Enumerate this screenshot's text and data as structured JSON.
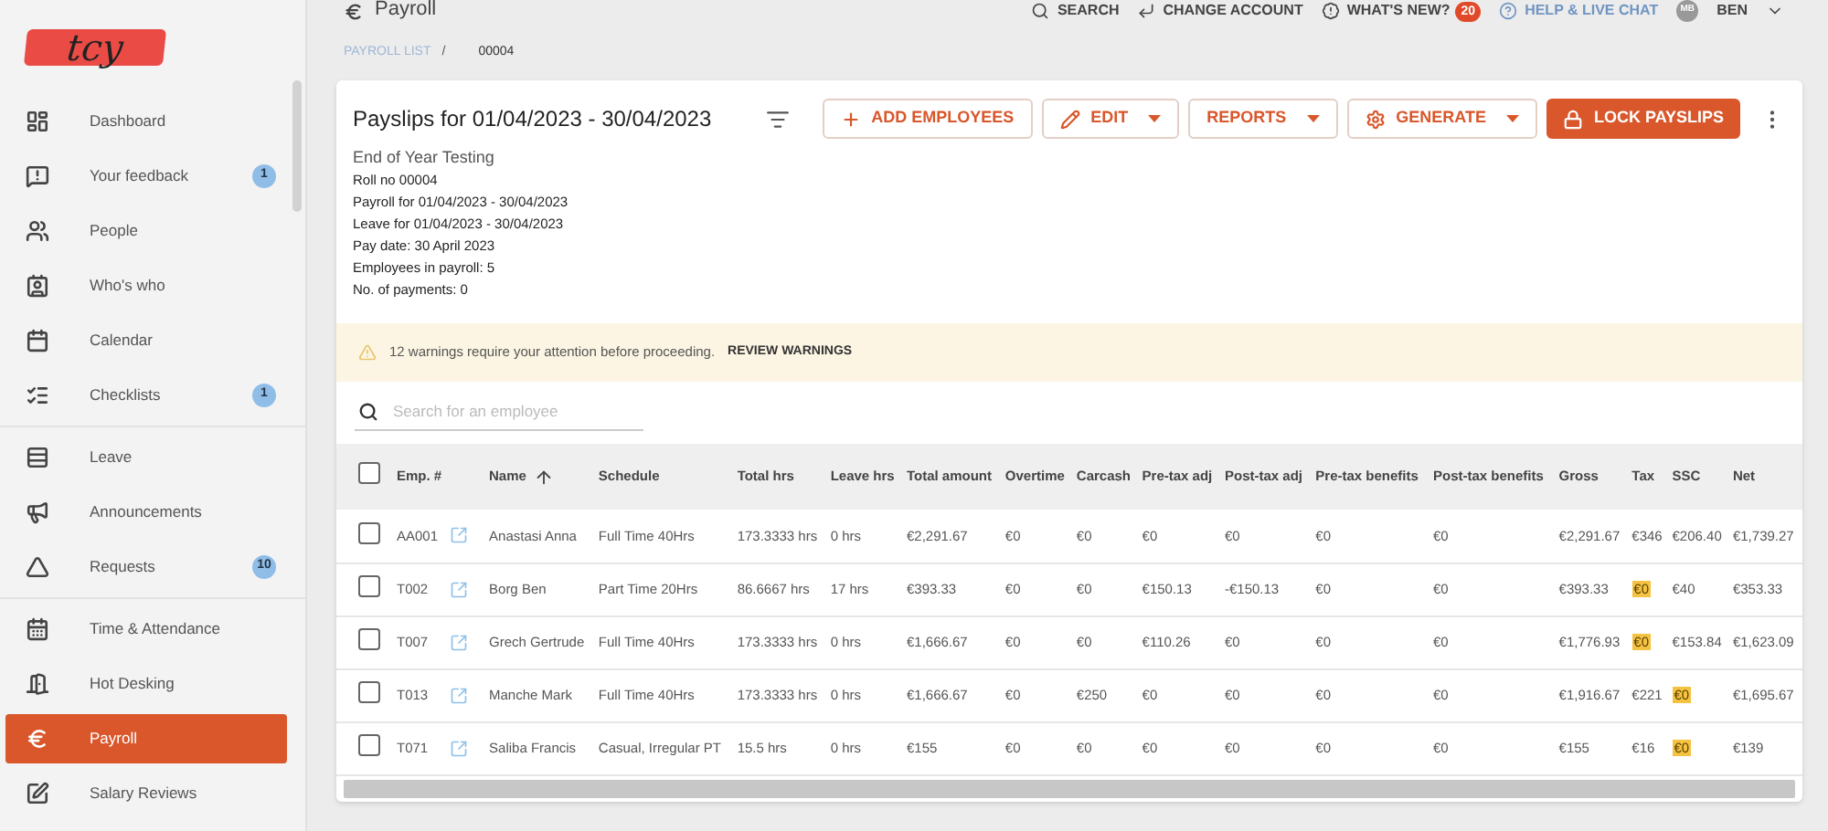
{
  "logo": {
    "text": "tcy"
  },
  "sidebar": {
    "items": [
      {
        "label": "Dashboard",
        "selected": false,
        "group_end": false
      },
      {
        "label": "Your feedback",
        "selected": false,
        "badge": "1",
        "group_end": false
      },
      {
        "label": "People",
        "selected": false,
        "group_end": false
      },
      {
        "label": "Who's who",
        "selected": false,
        "group_end": false
      },
      {
        "label": "Calendar",
        "selected": false,
        "group_end": false
      },
      {
        "label": "Checklists",
        "selected": false,
        "badge": "1",
        "group_end": true
      },
      {
        "label": "Leave",
        "selected": false,
        "group_end": false
      },
      {
        "label": "Announcements",
        "selected": false,
        "group_end": false
      },
      {
        "label": "Requests",
        "selected": false,
        "badge": "10",
        "group_end": true
      },
      {
        "label": "Time & Attendance",
        "selected": false,
        "group_end": false
      },
      {
        "label": "Hot Desking",
        "selected": false,
        "group_end": false
      },
      {
        "label": "Payroll",
        "selected": true,
        "group_end": false
      },
      {
        "label": "Salary Reviews",
        "selected": false,
        "group_end": false
      }
    ]
  },
  "page_title": "Payroll",
  "top_bar": {
    "search": "SEARCH",
    "change_account": "CHANGE ACCOUNT",
    "whats_new": "WHAT'S NEW?",
    "whats_new_badge": "20",
    "help": "HELP & LIVE CHAT",
    "avatar": "MB",
    "user": "BEN"
  },
  "breadcrumb": [
    {
      "label": "PAYROLL LIST",
      "kind": "link"
    },
    {
      "label": "/",
      "kind": "separator"
    },
    {
      "label": "00004",
      "kind": "current"
    }
  ],
  "card": {
    "title": "Payslips for 01/04/2023 - 30/04/2023",
    "buttons": [
      {
        "label": "ADD EMPLOYEES",
        "kind": "outline",
        "dropdown": false
      },
      {
        "label": "EDIT",
        "kind": "outline",
        "dropdown": true
      },
      {
        "label": "REPORTS",
        "kind": "outline",
        "dropdown": true
      },
      {
        "label": "GENERATE",
        "kind": "outline",
        "dropdown": true
      },
      {
        "label": "LOCK PAYSLIPS",
        "kind": "primary",
        "dropdown": false
      }
    ],
    "subtitle": "End of Year Testing",
    "details": [
      "Roll no 00004",
      "Payroll for 01/04/2023 - 30/04/2023",
      "Leave for 01/04/2023 - 30/04/2023",
      "Pay date: 30 April 2023",
      "Employees in payroll: 5",
      "No. of payments: 0"
    ],
    "warning": {
      "text": "12 warnings require your attention before proceeding.",
      "action": "REVIEW WARNINGS"
    },
    "search": {
      "placeholder": "Search for an employee"
    }
  },
  "table": {
    "select_all": {
      "checked": false
    },
    "columns": [
      {
        "label": "Emp. #",
        "sorted": false
      },
      {
        "label": "Name",
        "sorted": true
      },
      {
        "label": "Schedule",
        "sorted": false
      },
      {
        "label": "Total hrs",
        "sorted": false
      },
      {
        "label": "Leave hrs",
        "sorted": false
      },
      {
        "label": "Total amount",
        "sorted": false
      },
      {
        "label": "Overtime",
        "sorted": false
      },
      {
        "label": "Carcash",
        "sorted": false
      },
      {
        "label": "Pre-tax adj",
        "sorted": false
      },
      {
        "label": "Post-tax adj",
        "sorted": false
      },
      {
        "label": "Pre-tax benefits",
        "sorted": false
      },
      {
        "label": "Post-tax benefits",
        "sorted": false
      },
      {
        "label": "Gross",
        "sorted": false
      },
      {
        "label": "Tax",
        "sorted": false
      },
      {
        "label": "SSC",
        "sorted": false
      },
      {
        "label": "Net",
        "sorted": false
      }
    ],
    "rows": [
      {
        "checked": false,
        "cells": [
          {
            "text": "AA001",
            "flagged": false
          },
          {
            "text": "Anastasi Anna",
            "flagged": false
          },
          {
            "text": "Full Time 40Hrs",
            "flagged": false
          },
          {
            "text": "173.3333 hrs",
            "flagged": false
          },
          {
            "text": "0 hrs",
            "flagged": false
          },
          {
            "text": "€2,291.67",
            "flagged": false
          },
          {
            "text": "€0",
            "flagged": false
          },
          {
            "text": "€0",
            "flagged": false
          },
          {
            "text": "€0",
            "flagged": false
          },
          {
            "text": "€0",
            "flagged": false
          },
          {
            "text": "€0",
            "flagged": false
          },
          {
            "text": "€0",
            "flagged": false
          },
          {
            "text": "€2,291.67",
            "flagged": false
          },
          {
            "text": "€346",
            "flagged": false
          },
          {
            "text": "€206.40",
            "flagged": false
          },
          {
            "text": "€1,739.27",
            "flagged": false
          }
        ]
      },
      {
        "checked": false,
        "cells": [
          {
            "text": "T002",
            "flagged": false
          },
          {
            "text": "Borg Ben",
            "flagged": false
          },
          {
            "text": "Part Time 20Hrs",
            "flagged": false
          },
          {
            "text": "86.6667 hrs",
            "flagged": false
          },
          {
            "text": "17 hrs",
            "flagged": false
          },
          {
            "text": "€393.33",
            "flagged": false
          },
          {
            "text": "€0",
            "flagged": false
          },
          {
            "text": "€0",
            "flagged": false
          },
          {
            "text": "€150.13",
            "flagged": false
          },
          {
            "text": "-€150.13",
            "flagged": false
          },
          {
            "text": "€0",
            "flagged": false
          },
          {
            "text": "€0",
            "flagged": false
          },
          {
            "text": "€393.33",
            "flagged": false
          },
          {
            "text": "€0",
            "flagged": true
          },
          {
            "text": "€40",
            "flagged": false
          },
          {
            "text": "€353.33",
            "flagged": false
          }
        ]
      },
      {
        "checked": false,
        "cells": [
          {
            "text": "T007",
            "flagged": false
          },
          {
            "text": "Grech Gertrude",
            "flagged": false
          },
          {
            "text": "Full Time 40Hrs",
            "flagged": false
          },
          {
            "text": "173.3333 hrs",
            "flagged": false
          },
          {
            "text": "0 hrs",
            "flagged": false
          },
          {
            "text": "€1,666.67",
            "flagged": false
          },
          {
            "text": "€0",
            "flagged": false
          },
          {
            "text": "€0",
            "flagged": false
          },
          {
            "text": "€110.26",
            "flagged": false
          },
          {
            "text": "€0",
            "flagged": false
          },
          {
            "text": "€0",
            "flagged": false
          },
          {
            "text": "€0",
            "flagged": false
          },
          {
            "text": "€1,776.93",
            "flagged": false
          },
          {
            "text": "€0",
            "flagged": true
          },
          {
            "text": "€153.84",
            "flagged": false
          },
          {
            "text": "€1,623.09",
            "flagged": false
          }
        ]
      },
      {
        "checked": false,
        "cells": [
          {
            "text": "T013",
            "flagged": false
          },
          {
            "text": "Manche Mark",
            "flagged": false
          },
          {
            "text": "Full Time 40Hrs",
            "flagged": false
          },
          {
            "text": "173.3333 hrs",
            "flagged": false
          },
          {
            "text": "0 hrs",
            "flagged": false
          },
          {
            "text": "€1,666.67",
            "flagged": false
          },
          {
            "text": "€0",
            "flagged": false
          },
          {
            "text": "€250",
            "flagged": false
          },
          {
            "text": "€0",
            "flagged": false
          },
          {
            "text": "€0",
            "flagged": false
          },
          {
            "text": "€0",
            "flagged": false
          },
          {
            "text": "€0",
            "flagged": false
          },
          {
            "text": "€1,916.67",
            "flagged": false
          },
          {
            "text": "€221",
            "flagged": false
          },
          {
            "text": "€0",
            "flagged": true
          },
          {
            "text": "€1,695.67",
            "flagged": false
          }
        ]
      },
      {
        "checked": false,
        "cells": [
          {
            "text": "T071",
            "flagged": false
          },
          {
            "text": "Saliba Francis",
            "flagged": false
          },
          {
            "text": "Casual, Irregular PT",
            "flagged": false
          },
          {
            "text": "15.5 hrs",
            "flagged": false
          },
          {
            "text": "0 hrs",
            "flagged": false
          },
          {
            "text": "€155",
            "flagged": false
          },
          {
            "text": "€0",
            "flagged": false
          },
          {
            "text": "€0",
            "flagged": false
          },
          {
            "text": "€0",
            "flagged": false
          },
          {
            "text": "€0",
            "flagged": false
          },
          {
            "text": "€0",
            "flagged": false
          },
          {
            "text": "€0",
            "flagged": false
          },
          {
            "text": "€155",
            "flagged": false
          },
          {
            "text": "€16",
            "flagged": false
          },
          {
            "text": "€0",
            "flagged": true
          },
          {
            "text": "€139",
            "flagged": false
          }
        ]
      }
    ]
  }
}
